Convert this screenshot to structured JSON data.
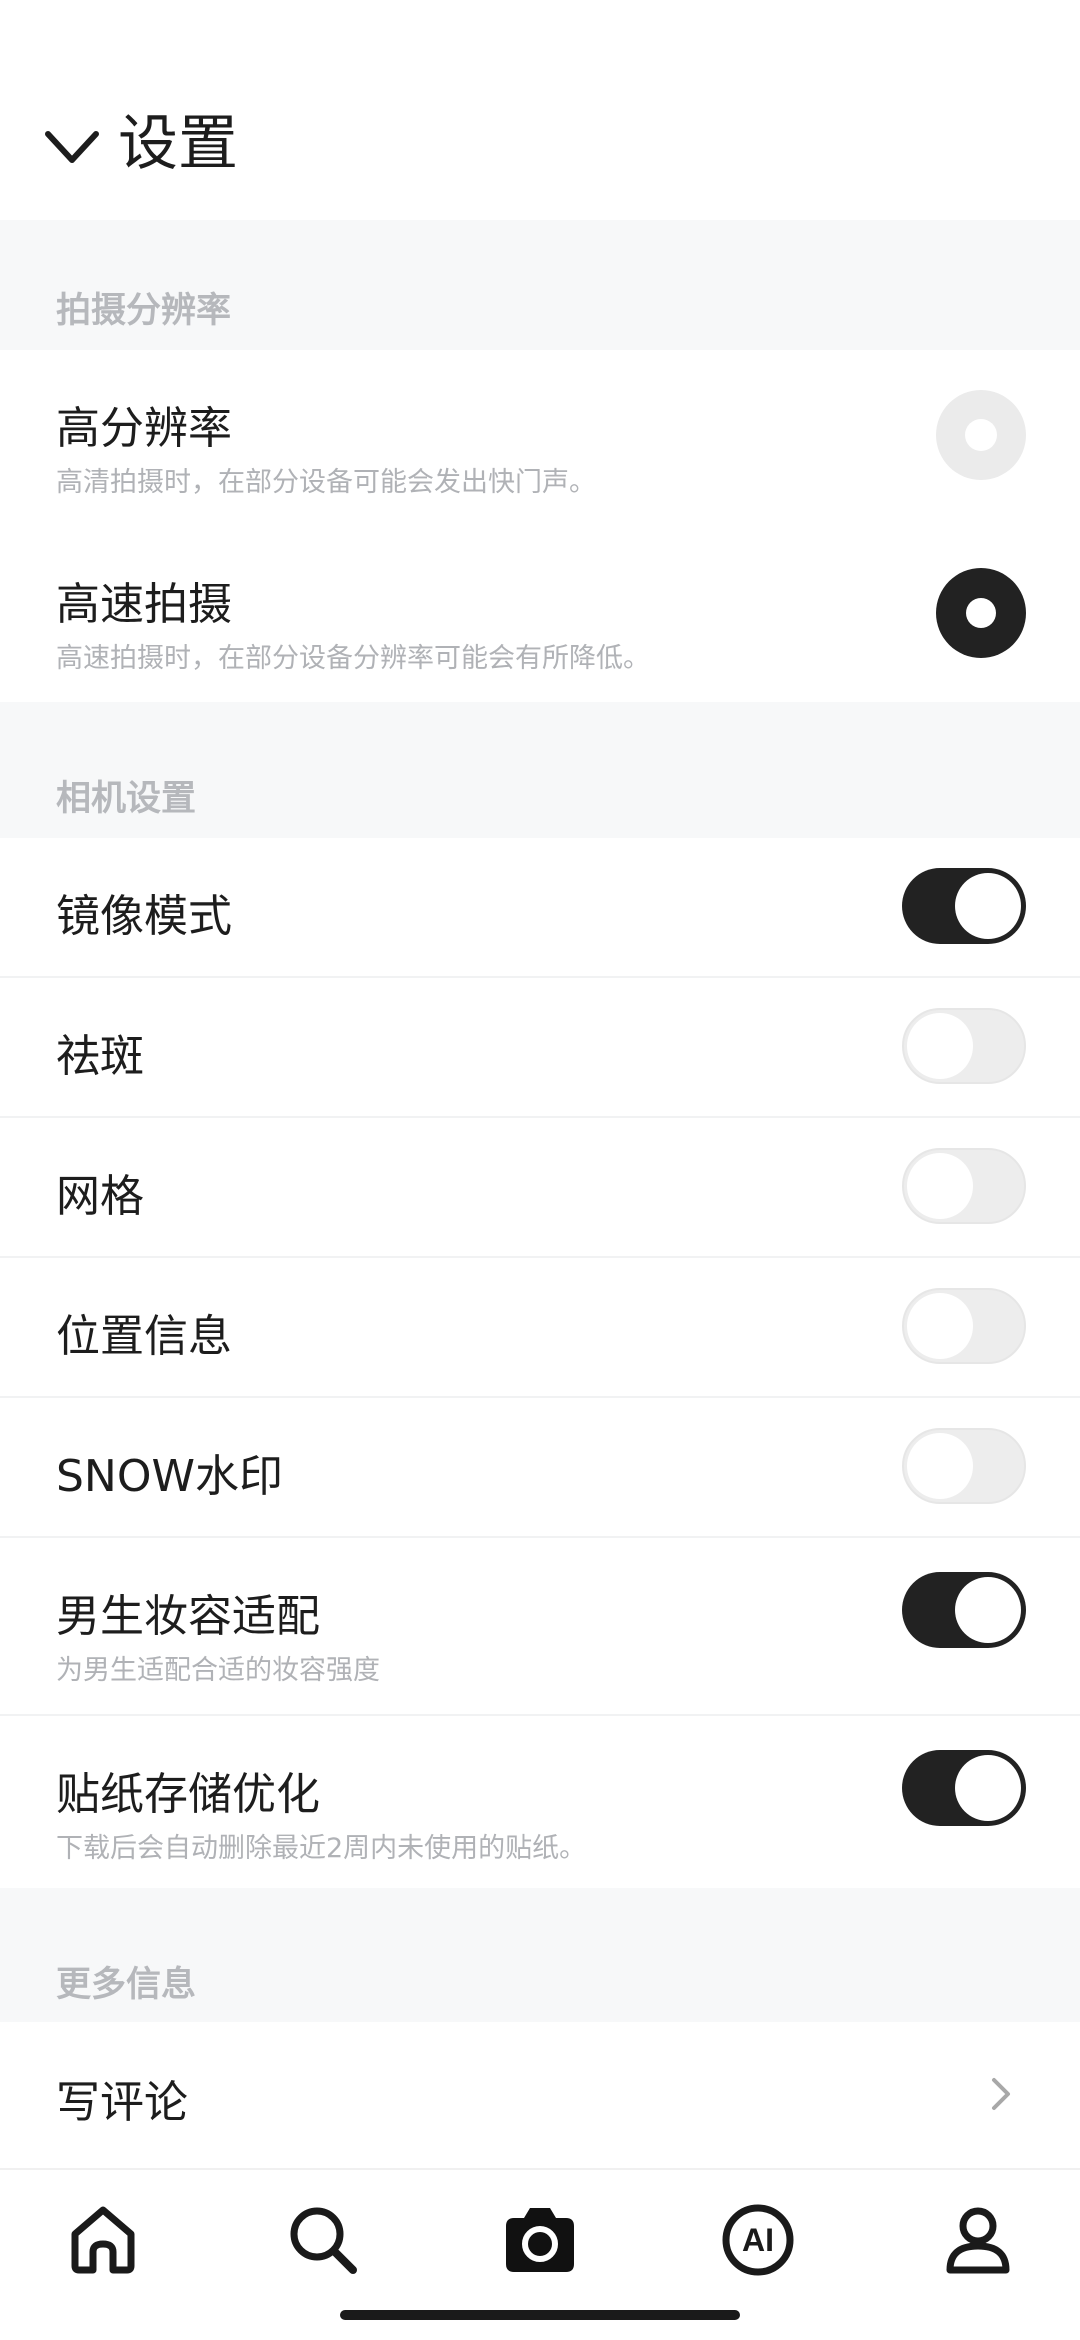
{
  "header": {
    "title": "设置"
  },
  "sections": {
    "resolution": {
      "label": "拍摄分辨率"
    },
    "camera": {
      "label": "相机设置"
    },
    "more": {
      "label": "更多信息"
    }
  },
  "resolution_items": [
    {
      "title": "高分辨率",
      "desc": "高清拍摄时，在部分设备可能会发出快门声。",
      "selected": false
    },
    {
      "title": "高速拍摄",
      "desc": "高速拍摄时，在部分设备分辨率可能会有所降低。",
      "selected": true
    }
  ],
  "camera_items": [
    {
      "title": "镜像模式",
      "on": true
    },
    {
      "title": "祛斑",
      "on": false
    },
    {
      "title": "网格",
      "on": false
    },
    {
      "title": "位置信息",
      "on": false
    },
    {
      "title": "SNOW水印",
      "on": false
    },
    {
      "title": "男生妆容适配",
      "desc": "为男生适配合适的妆容强度",
      "on": true
    },
    {
      "title": "贴纸存储优化",
      "desc": "下载后会自动删除最近2周内未使用的贴纸。",
      "on": true
    }
  ],
  "more_items": [
    {
      "title": "写评论"
    }
  ],
  "tabs": {
    "home": "home-icon",
    "search": "search-icon",
    "camera": "camera-icon",
    "ai": "ai-icon",
    "profile": "profile-icon",
    "ai_text": "AI"
  },
  "colors": {
    "accent": "#222222",
    "section_bg": "#f7f8f9",
    "muted_text": "#b0b2b6"
  }
}
